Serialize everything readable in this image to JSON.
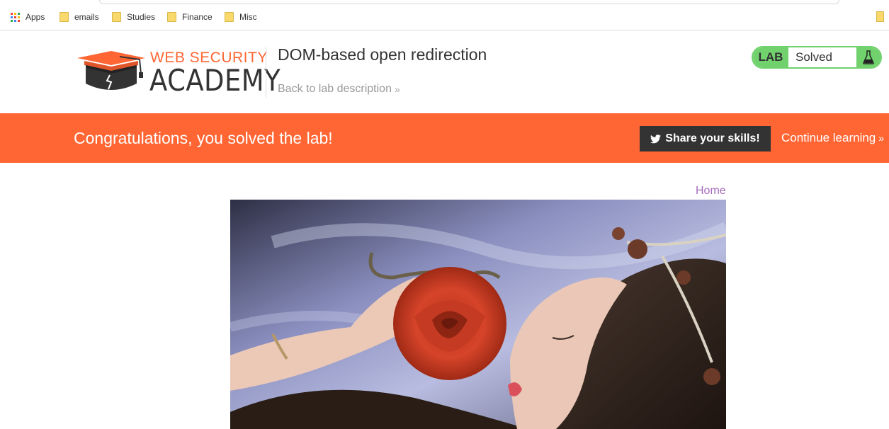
{
  "bookmarks": {
    "items": [
      {
        "label": "Apps",
        "icon": "apps-grid-icon"
      },
      {
        "label": "emails",
        "icon": "folder-icon"
      },
      {
        "label": "Studies",
        "icon": "folder-icon"
      },
      {
        "label": "Finance",
        "icon": "folder-icon"
      },
      {
        "label": "Misc",
        "icon": "folder-icon"
      }
    ]
  },
  "header": {
    "logo_top": "WEB SECURITY",
    "logo_bottom": "ACADEMY",
    "lab_title": "DOM-based open redirection",
    "back_link": "Back to lab description",
    "status_tag": "LAB",
    "status_text": "Solved",
    "status_icon": "flask-icon"
  },
  "banner": {
    "message": "Congratulations, you solved the lab!",
    "share_label": "Share your skills!",
    "share_icon": "twitter-icon",
    "continue_label": "Continue learning"
  },
  "content": {
    "home_link": "Home",
    "image_description_icon": "blog-post-image"
  },
  "colors": {
    "accent_orange": "#ff6633",
    "lab_green": "#70d16d",
    "dark": "#333333",
    "home_link": "#a66bbd"
  }
}
